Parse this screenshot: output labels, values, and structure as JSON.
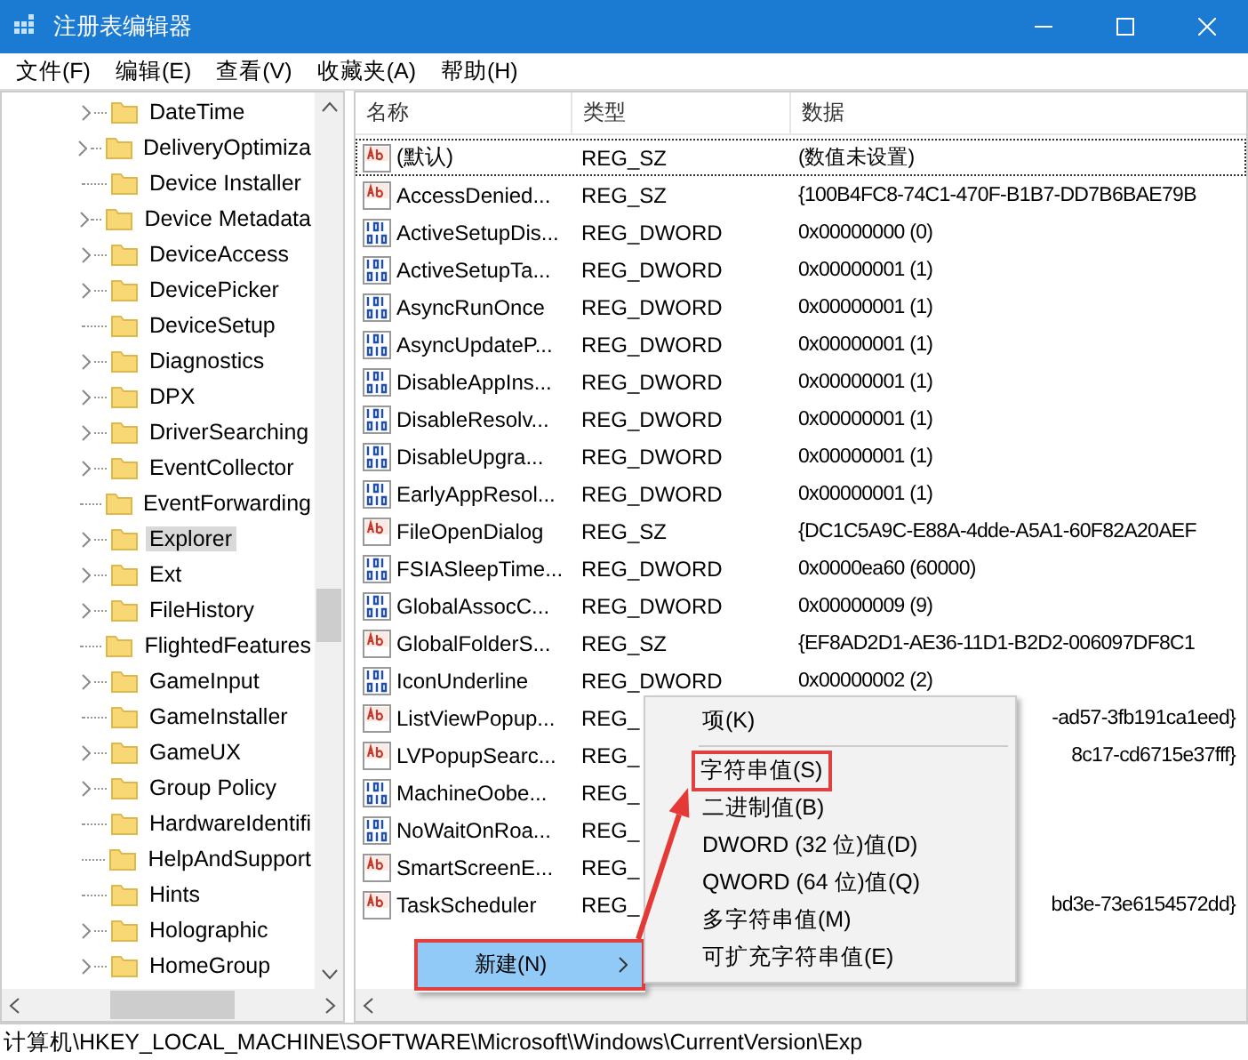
{
  "window": {
    "title": "注册表编辑器"
  },
  "menu": [
    "文件(F)",
    "编辑(E)",
    "查看(V)",
    "收藏夹(A)",
    "帮助(H)"
  ],
  "tree": [
    {
      "label": "DateTime",
      "expandable": true,
      "selected": false
    },
    {
      "label": "DeliveryOptimiza",
      "expandable": true,
      "selected": false
    },
    {
      "label": "Device Installer",
      "expandable": false,
      "selected": false
    },
    {
      "label": "Device Metadata",
      "expandable": true,
      "selected": false
    },
    {
      "label": "DeviceAccess",
      "expandable": true,
      "selected": false
    },
    {
      "label": "DevicePicker",
      "expandable": true,
      "selected": false
    },
    {
      "label": "DeviceSetup",
      "expandable": false,
      "selected": false
    },
    {
      "label": "Diagnostics",
      "expandable": true,
      "selected": false
    },
    {
      "label": "DPX",
      "expandable": true,
      "selected": false
    },
    {
      "label": "DriverSearching",
      "expandable": true,
      "selected": false
    },
    {
      "label": "EventCollector",
      "expandable": true,
      "selected": false
    },
    {
      "label": "EventForwarding",
      "expandable": false,
      "selected": false
    },
    {
      "label": "Explorer",
      "expandable": true,
      "selected": true
    },
    {
      "label": "Ext",
      "expandable": true,
      "selected": false
    },
    {
      "label": "FileHistory",
      "expandable": true,
      "selected": false
    },
    {
      "label": "FlightedFeatures",
      "expandable": false,
      "selected": false
    },
    {
      "label": "GameInput",
      "expandable": true,
      "selected": false
    },
    {
      "label": "GameInstaller",
      "expandable": false,
      "selected": false
    },
    {
      "label": "GameUX",
      "expandable": true,
      "selected": false
    },
    {
      "label": "Group Policy",
      "expandable": true,
      "selected": false
    },
    {
      "label": "HardwareIdentifi",
      "expandable": false,
      "selected": false
    },
    {
      "label": "HelpAndSupport",
      "expandable": false,
      "selected": false
    },
    {
      "label": "Hints",
      "expandable": false,
      "selected": false
    },
    {
      "label": "Holographic",
      "expandable": true,
      "selected": false
    },
    {
      "label": "HomeGroup",
      "expandable": true,
      "selected": false
    }
  ],
  "table": {
    "columns": [
      "名称",
      "类型",
      "数据"
    ],
    "rows": [
      {
        "kind": "sz",
        "name": "(默认)",
        "type": "REG_SZ",
        "data": "(数值未设置)",
        "focused": true
      },
      {
        "kind": "sz",
        "name": "AccessDenied...",
        "type": "REG_SZ",
        "data": "{100B4FC8-74C1-470F-B1B7-DD7B6BAE79B",
        "focused": false
      },
      {
        "kind": "bin",
        "name": "ActiveSetupDis...",
        "type": "REG_DWORD",
        "data": "0x00000000 (0)",
        "focused": false
      },
      {
        "kind": "bin",
        "name": "ActiveSetupTa...",
        "type": "REG_DWORD",
        "data": "0x00000001 (1)",
        "focused": false
      },
      {
        "kind": "bin",
        "name": "AsyncRunOnce",
        "type": "REG_DWORD",
        "data": "0x00000001 (1)",
        "focused": false
      },
      {
        "kind": "bin",
        "name": "AsyncUpdateP...",
        "type": "REG_DWORD",
        "data": "0x00000001 (1)",
        "focused": false
      },
      {
        "kind": "bin",
        "name": "DisableAppIns...",
        "type": "REG_DWORD",
        "data": "0x00000001 (1)",
        "focused": false
      },
      {
        "kind": "bin",
        "name": "DisableResolv...",
        "type": "REG_DWORD",
        "data": "0x00000001 (1)",
        "focused": false
      },
      {
        "kind": "bin",
        "name": "DisableUpgra...",
        "type": "REG_DWORD",
        "data": "0x00000001 (1)",
        "focused": false
      },
      {
        "kind": "bin",
        "name": "EarlyAppResol...",
        "type": "REG_DWORD",
        "data": "0x00000001 (1)",
        "focused": false
      },
      {
        "kind": "sz",
        "name": "FileOpenDialog",
        "type": "REG_SZ",
        "data": "{DC1C5A9C-E88A-4dde-A5A1-60F82A20AEF",
        "focused": false
      },
      {
        "kind": "bin",
        "name": "FSIASleepTime...",
        "type": "REG_DWORD",
        "data": "0x0000ea60 (60000)",
        "focused": false
      },
      {
        "kind": "bin",
        "name": "GlobalAssocC...",
        "type": "REG_DWORD",
        "data": "0x00000009 (9)",
        "focused": false
      },
      {
        "kind": "sz",
        "name": "GlobalFolderS...",
        "type": "REG_SZ",
        "data": "{EF8AD2D1-AE36-11D1-B2D2-006097DF8C1",
        "focused": false
      },
      {
        "kind": "bin",
        "name": "IconUnderline",
        "type": "REG_DWORD",
        "data": "0x00000002 (2)",
        "focused": false
      },
      {
        "kind": "sz",
        "name": "ListViewPopup...",
        "type": "REG_",
        "data_tail": "-ad57-3fb191ca1eed}",
        "focused": false
      },
      {
        "kind": "sz",
        "name": "LVPopupSearc...",
        "type": "REG_",
        "data_tail": "8c17-cd6715e37fff}",
        "focused": false
      },
      {
        "kind": "bin",
        "name": "MachineOobe...",
        "type": "REG_",
        "focused": false
      },
      {
        "kind": "bin",
        "name": "NoWaitOnRoa...",
        "type": "REG_",
        "focused": false
      },
      {
        "kind": "sz",
        "name": "SmartScreenE...",
        "type": "REG_",
        "focused": false
      },
      {
        "kind": "sz",
        "name": "TaskScheduler",
        "type": "REG_",
        "data_tail": "bd3e-73e6154572dd}",
        "focused": false
      }
    ]
  },
  "context_menu": {
    "items": [
      {
        "label": "新建(N)",
        "selected": true,
        "highlighted": true
      }
    ]
  },
  "submenu": {
    "items": [
      {
        "label": "项(K)",
        "highlighted": false,
        "separator_after": true
      },
      {
        "label": "字符串值(S)",
        "highlighted": true,
        "separator_after": false
      },
      {
        "label": "二进制值(B)",
        "highlighted": false,
        "separator_after": false
      },
      {
        "label": "DWORD (32 位)值(D)",
        "highlighted": false,
        "separator_after": false
      },
      {
        "label": "QWORD (64 位)值(Q)",
        "highlighted": false,
        "separator_after": false
      },
      {
        "label": "多字符串值(M)",
        "highlighted": false,
        "separator_after": false
      },
      {
        "label": "可扩充字符串值(E)",
        "highlighted": false,
        "separator_after": false
      }
    ]
  },
  "status_bar": "计算机\\HKEY_LOCAL_MACHINE\\SOFTWARE\\Microsoft\\Windows\\CurrentVersion\\Exp"
}
